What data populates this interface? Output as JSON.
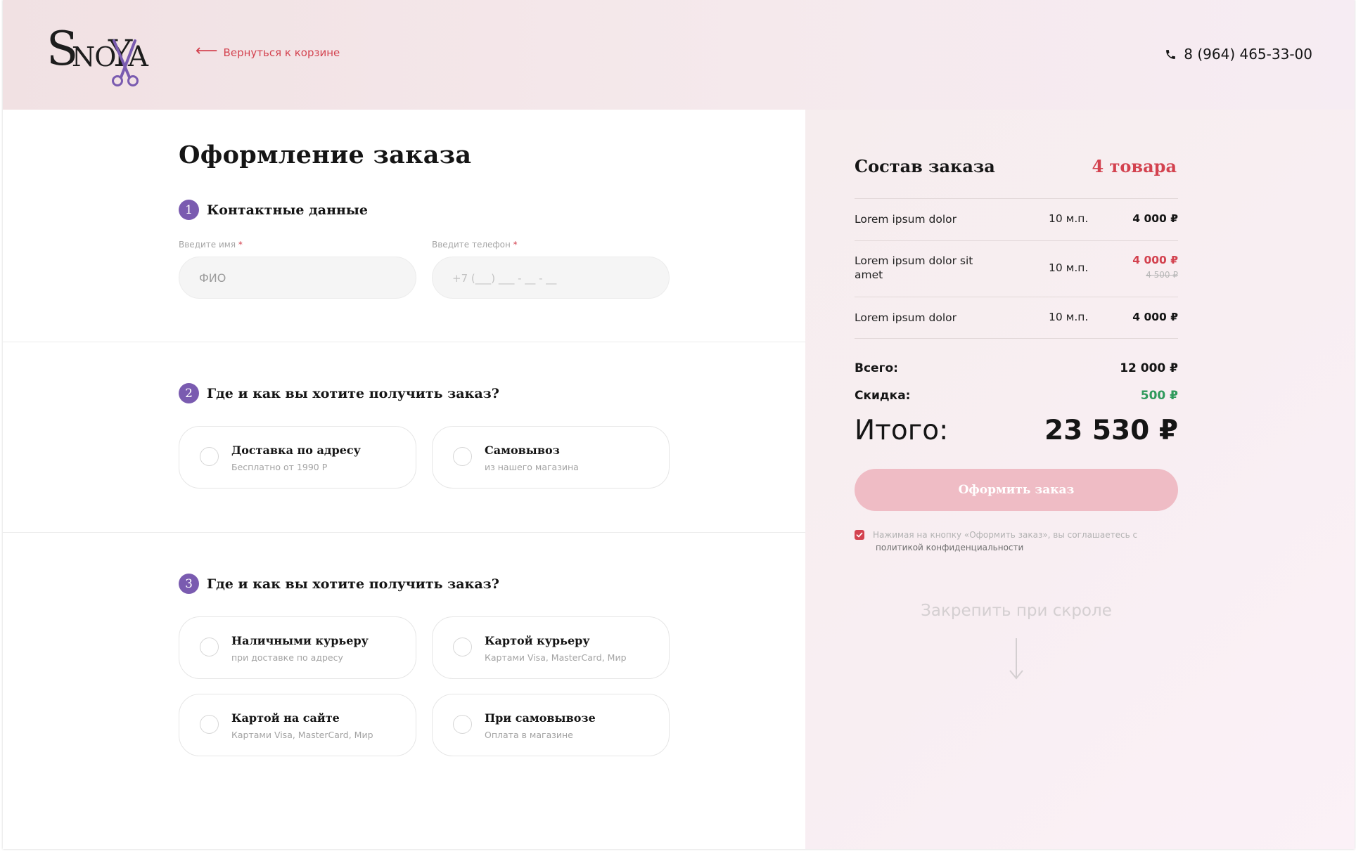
{
  "header": {
    "logo_text": "SnoYa",
    "back_link": "Вернуться к корзине",
    "phone": "8 (964) 465-33-00"
  },
  "checkout": {
    "title": "Оформление заказа",
    "contact": {
      "step": "1",
      "title": "Контактные данные",
      "name_label": "Введите имя",
      "name_placeholder": "ФИО",
      "phone_label": "Введите телефон",
      "phone_placeholder": "+7 (___) ___ - __ - __",
      "required_mark": "*"
    },
    "delivery": {
      "step": "2",
      "title": "Где и как вы хотите получить заказ?",
      "options": [
        {
          "title": "Доставка по адресу",
          "subtitle": "Бесплатно от 1990 Р"
        },
        {
          "title": "Самовывоз",
          "subtitle": "из нашего магазина"
        }
      ]
    },
    "payment": {
      "step": "3",
      "title": "Где и как вы хотите получить заказ?",
      "options": [
        {
          "title": "Наличными курьеру",
          "subtitle": "при доставке по адресу"
        },
        {
          "title": "Картой курьеру",
          "subtitle": "Картами Visa, MasterCard, Мир"
        },
        {
          "title": "Картой на сайте",
          "subtitle": "Картами Visa, MasterCard, Мир"
        },
        {
          "title": "При самовывозе",
          "subtitle": "Оплата в магазине"
        }
      ]
    }
  },
  "summary": {
    "title": "Состав заказа",
    "count": "4 товара",
    "items": [
      {
        "name": "Lorem ipsum dolor",
        "qty": "10 м.п.",
        "price": "4 000 ₽",
        "old_price": ""
      },
      {
        "name": "Lorem ipsum dolor sit amet",
        "qty": "10 м.п.",
        "price": "4 000 ₽",
        "old_price": "4 500 ₽"
      },
      {
        "name": "Lorem ipsum dolor",
        "qty": "10 м.п.",
        "price": "4 000 ₽",
        "old_price": ""
      }
    ],
    "total_label": "Всего:",
    "total_value": "12 000 ₽",
    "discount_label": "Скидка:",
    "discount_value": "500 ₽",
    "grand_label": "Итого:",
    "grand_value": "23 530 ₽",
    "submit_label": "Оформить заказ",
    "consent_text": "Нажимая на кнопку «Оформить заказ», вы соглашаетесь с",
    "consent_link": "политикой конфиденциальности",
    "consent_checked": true,
    "pin_note": "Закрепить при скроле"
  },
  "colors": {
    "accent": "#d3424f",
    "step_badge": "#7a5bb0",
    "discount": "#2f9a5c",
    "button": "#efbcc5"
  }
}
